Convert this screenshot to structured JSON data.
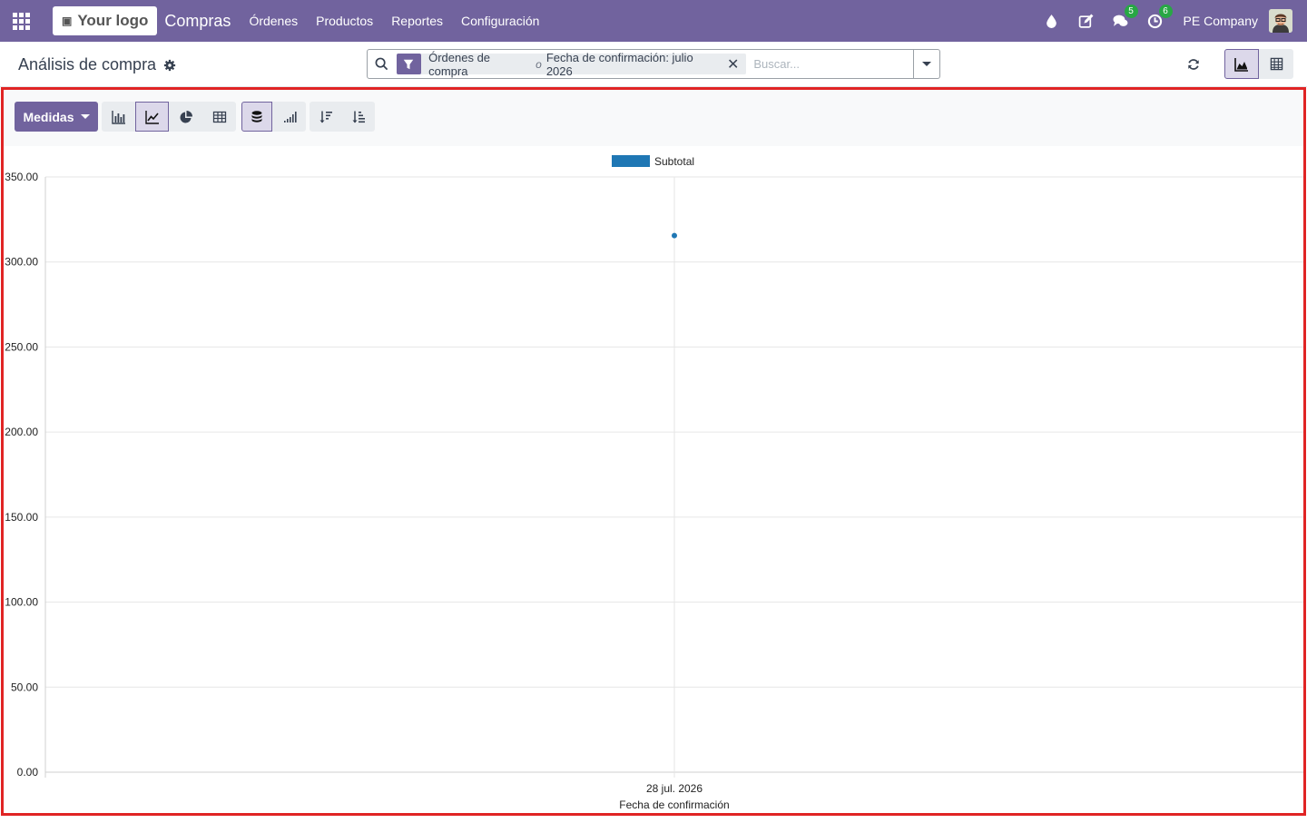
{
  "navbar": {
    "logo_text": "Your logo",
    "app_name": "Compras",
    "menu": [
      {
        "label": "Órdenes"
      },
      {
        "label": "Productos"
      },
      {
        "label": "Reportes"
      },
      {
        "label": "Configuración"
      }
    ],
    "messages_count": "5",
    "activities_count": "6",
    "company": "PE Company",
    "icons": [
      "apps-grid-icon",
      "drop-icon",
      "edit-icon",
      "chat-icon",
      "clock-icon"
    ],
    "colors": {
      "bar": "#71639e",
      "badge": "#28a745"
    }
  },
  "control_panel": {
    "breadcrumb": "Análisis de compra",
    "facet": {
      "value1": "Órdenes de compra",
      "separator": "o",
      "value2": "Fecha de confirmación: julio 2026"
    },
    "search_placeholder": "Buscar...",
    "views": [
      "graph",
      "pivot"
    ],
    "active_view": "graph"
  },
  "toolbar": {
    "measures_label": "Medidas",
    "chart_types": [
      "bar",
      "line",
      "pie",
      "table"
    ],
    "active_chart_type": "line",
    "stacked_active": true
  },
  "chart_data": {
    "type": "line",
    "title": "",
    "legend": [
      "Subtotal"
    ],
    "legend_position": "top-center",
    "series": [
      {
        "name": "Subtotal",
        "color": "#1f77b4",
        "values": [
          315.5
        ]
      }
    ],
    "categories": [
      "28 jul. 2026"
    ],
    "xlabel": "Fecha de confirmación",
    "ylabel": "",
    "ylim": [
      0,
      350
    ],
    "yticks": [
      "0.00",
      "50.00",
      "100.00",
      "150.00",
      "200.00",
      "250.00",
      "300.00",
      "350.00"
    ],
    "grid": true
  }
}
